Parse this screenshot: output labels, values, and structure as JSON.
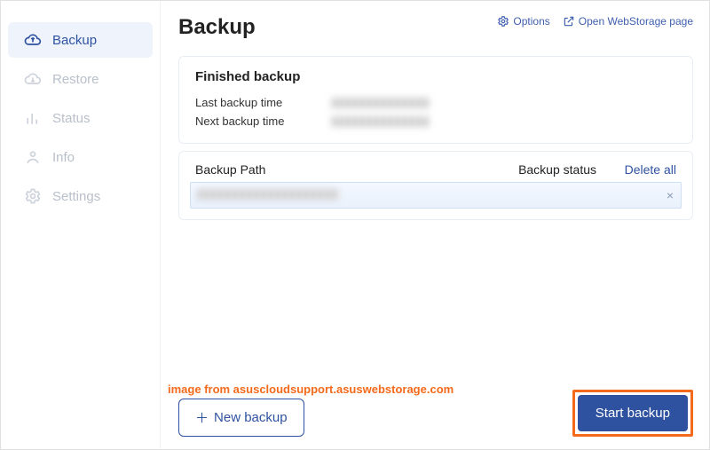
{
  "sidebar": {
    "items": [
      {
        "label": "Backup",
        "active": true
      },
      {
        "label": "Restore",
        "active": false
      },
      {
        "label": "Status",
        "active": false
      },
      {
        "label": "Info",
        "active": false
      },
      {
        "label": "Settings",
        "active": false
      }
    ]
  },
  "header": {
    "title": "Backup",
    "options_label": "Options",
    "open_page_label": "Open WebStorage page"
  },
  "finished_card": {
    "title": "Finished backup",
    "last_label": "Last backup time",
    "last_value": "████████",
    "next_label": "Next backup time",
    "next_value": "████████"
  },
  "path_table": {
    "columns": {
      "path": "Backup Path",
      "status": "Backup status",
      "delete_all": "Delete all"
    },
    "rows": [
      {
        "path_display": "████████████",
        "remove_glyph": "×"
      }
    ]
  },
  "actions": {
    "new_label": "New  backup",
    "new_prefix": "＋",
    "start_label": "Start backup"
  },
  "attribution": "image from asuscloudsupport.asuswebstorage.com"
}
